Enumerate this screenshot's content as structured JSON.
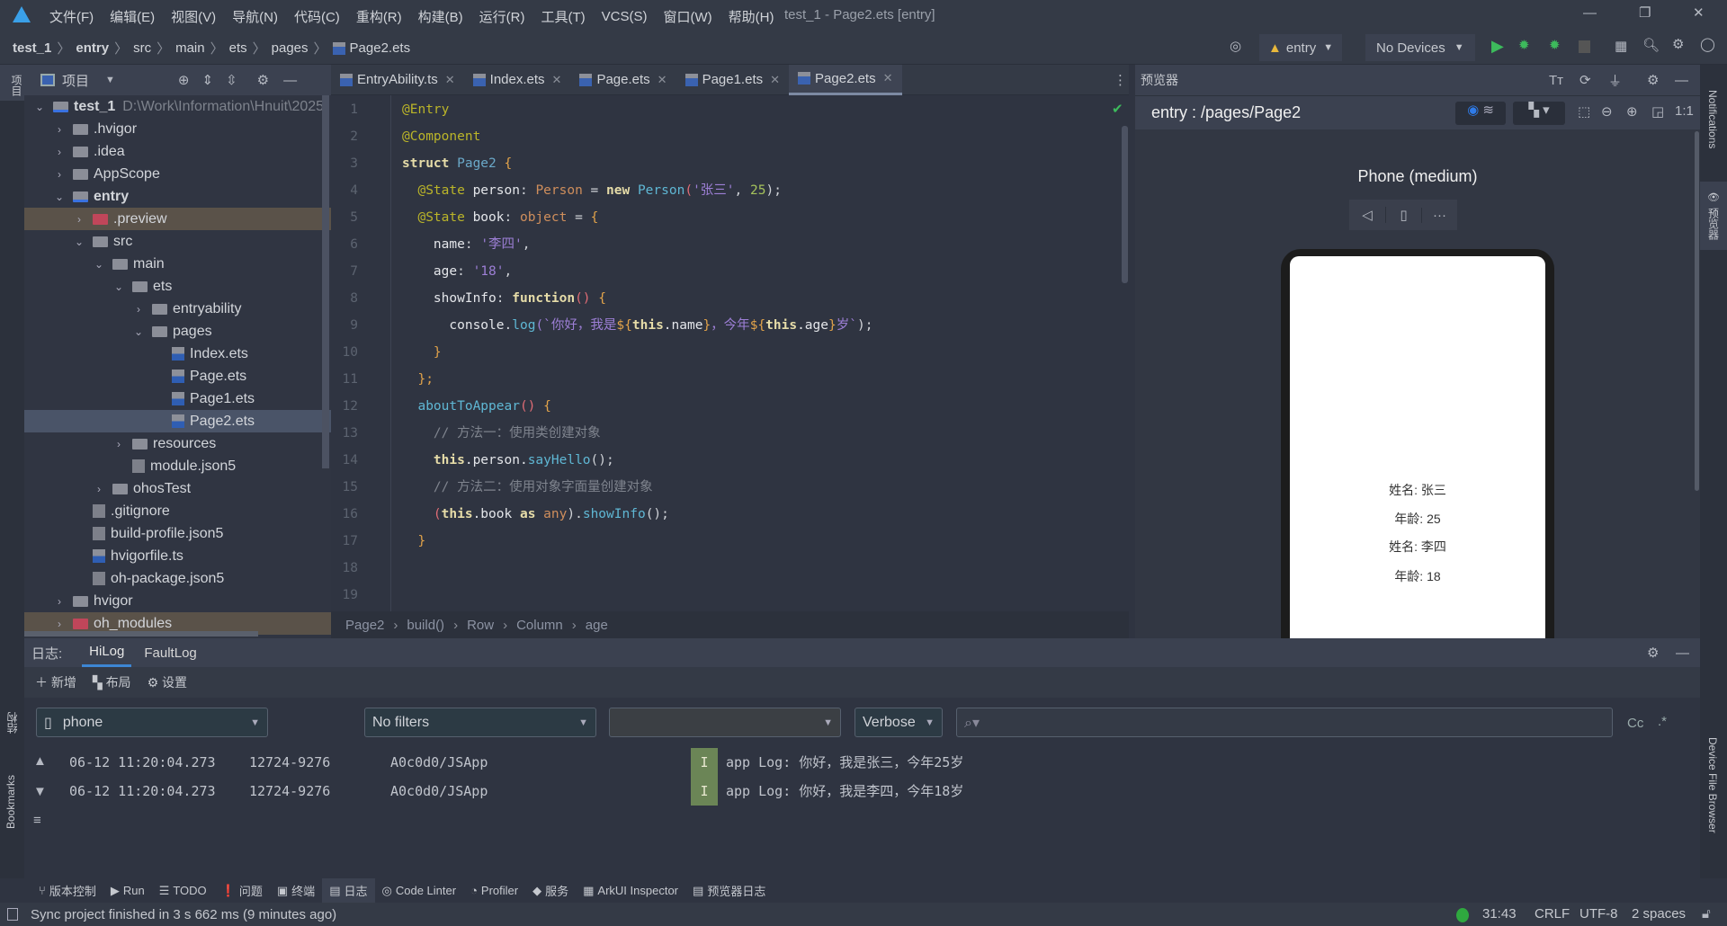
{
  "titlebar": {
    "menus": [
      "文件(F)",
      "编辑(E)",
      "视图(V)",
      "导航(N)",
      "代码(C)",
      "重构(R)",
      "构建(B)",
      "运行(R)",
      "工具(T)",
      "VCS(S)",
      "窗口(W)",
      "帮助(H)"
    ],
    "title": "test_1 - Page2.ets [entry]"
  },
  "breadcrumb": [
    "test_1",
    "entry",
    "src",
    "main",
    "ets",
    "pages",
    "Page2.ets"
  ],
  "run": {
    "module": "entry",
    "device": "No Devices"
  },
  "project": {
    "title": "项目",
    "strip_label": "项目",
    "tree": [
      {
        "label": "test_1",
        "path": "D:\\Work\\Information\\Hnuit\\2025",
        "depth": 0,
        "arrow": "v",
        "icon": "module",
        "bold": true
      },
      {
        "label": ".hvigor",
        "depth": 1,
        "arrow": ">",
        "icon": "folder"
      },
      {
        "label": ".idea",
        "depth": 1,
        "arrow": ">",
        "icon": "folder"
      },
      {
        "label": "AppScope",
        "depth": 1,
        "arrow": ">",
        "icon": "folder"
      },
      {
        "label": "entry",
        "depth": 1,
        "arrow": "v",
        "icon": "module",
        "bold": true
      },
      {
        "label": ".preview",
        "depth": 2,
        "arrow": ">",
        "icon": "folder-red",
        "hl": true
      },
      {
        "label": "src",
        "depth": 2,
        "arrow": "v",
        "icon": "folder"
      },
      {
        "label": "main",
        "depth": 3,
        "arrow": "v",
        "icon": "folder"
      },
      {
        "label": "ets",
        "depth": 4,
        "arrow": "v",
        "icon": "folder"
      },
      {
        "label": "entryability",
        "depth": 5,
        "arrow": ">",
        "icon": "folder"
      },
      {
        "label": "pages",
        "depth": 5,
        "arrow": "v",
        "icon": "folder"
      },
      {
        "label": "Index.ets",
        "depth": 6,
        "arrow": "",
        "icon": "ets"
      },
      {
        "label": "Page.ets",
        "depth": 6,
        "arrow": "",
        "icon": "ets"
      },
      {
        "label": "Page1.ets",
        "depth": 6,
        "arrow": "",
        "icon": "ets"
      },
      {
        "label": "Page2.ets",
        "depth": 6,
        "arrow": "",
        "icon": "ets",
        "sel": true
      },
      {
        "label": "resources",
        "depth": 4,
        "arrow": ">",
        "icon": "folder"
      },
      {
        "label": "module.json5",
        "depth": 4,
        "arrow": "",
        "icon": "json"
      },
      {
        "label": "ohosTest",
        "depth": 3,
        "arrow": ">",
        "icon": "folder"
      },
      {
        "label": ".gitignore",
        "depth": 2,
        "arrow": "",
        "icon": "file"
      },
      {
        "label": "build-profile.json5",
        "depth": 2,
        "arrow": "",
        "icon": "json"
      },
      {
        "label": "hvigorfile.ts",
        "depth": 2,
        "arrow": "",
        "icon": "ts"
      },
      {
        "label": "oh-package.json5",
        "depth": 2,
        "arrow": "",
        "icon": "json"
      },
      {
        "label": "hvigor",
        "depth": 1,
        "arrow": ">",
        "icon": "folder"
      },
      {
        "label": "oh_modules",
        "depth": 1,
        "arrow": ">",
        "icon": "folder-red",
        "hl": true
      }
    ]
  },
  "tabs": [
    {
      "label": "EntryAbility.ts"
    },
    {
      "label": "Index.ets"
    },
    {
      "label": "Page.ets"
    },
    {
      "label": "Page1.ets"
    },
    {
      "label": "Page2.ets",
      "active": true
    }
  ],
  "editor": {
    "lines": [
      [
        [
          "@Entry",
          "an"
        ]
      ],
      [
        [
          "@Component",
          "an"
        ]
      ],
      [
        [
          "struct ",
          "k"
        ],
        [
          "Page2 ",
          "tc"
        ],
        [
          "{",
          "br"
        ]
      ],
      [
        [
          "  @State ",
          "an"
        ],
        [
          "person",
          "id"
        ],
        [
          ": ",
          "pn"
        ],
        [
          "Person",
          "ty"
        ],
        [
          " = ",
          "pn"
        ],
        [
          "new ",
          "k"
        ],
        [
          "Person",
          "fn"
        ],
        [
          "(",
          "pr"
        ],
        [
          "'张三'",
          "st"
        ],
        [
          ", ",
          "pn"
        ],
        [
          "25",
          "nu"
        ],
        [
          ");",
          "pn"
        ]
      ],
      [
        [
          "  @State ",
          "an"
        ],
        [
          "book",
          "id"
        ],
        [
          ": ",
          "pn"
        ],
        [
          "object",
          "ty"
        ],
        [
          " = ",
          "pn"
        ],
        [
          "{",
          "br"
        ]
      ],
      [
        [
          "    name",
          "id"
        ],
        [
          ": ",
          "pn"
        ],
        [
          "'李四'",
          "st"
        ],
        [
          ",",
          "pn"
        ]
      ],
      [
        [
          "    age",
          "id"
        ],
        [
          ": ",
          "pn"
        ],
        [
          "'18'",
          "st"
        ],
        [
          ",",
          "pn"
        ]
      ],
      [
        [
          "    showInfo",
          "id"
        ],
        [
          ": ",
          "pn"
        ],
        [
          "function",
          "k"
        ],
        [
          "() ",
          "pr"
        ],
        [
          "{",
          "br"
        ]
      ],
      [
        [
          "      console",
          "id"
        ],
        [
          ".",
          "pn"
        ],
        [
          "log",
          "fn"
        ],
        [
          "(`你好，我是",
          "st"
        ],
        [
          "${",
          "br"
        ],
        [
          "this",
          "k"
        ],
        [
          ".name",
          "id"
        ],
        [
          "}",
          "br"
        ],
        [
          "，今年",
          "st"
        ],
        [
          "${",
          "br"
        ],
        [
          "this",
          "k"
        ],
        [
          ".age",
          "id"
        ],
        [
          "}",
          "br"
        ],
        [
          "岁`",
          "st"
        ],
        [
          ");",
          "pn"
        ]
      ],
      [
        [
          "    }",
          "br"
        ]
      ],
      [
        [
          "  };",
          "br"
        ]
      ],
      [
        [
          "  aboutToAppear",
          "fn"
        ],
        [
          "() ",
          "pr"
        ],
        [
          "{",
          "br"
        ]
      ],
      [
        [
          "    // 方法一：使用类创建对象",
          "cm"
        ]
      ],
      [
        [
          "    this",
          "k"
        ],
        [
          ".person.",
          "id"
        ],
        [
          "sayHello",
          "fn"
        ],
        [
          "();",
          "pn"
        ]
      ],
      [
        [
          "    // 方法二：使用对象字面量创建对象",
          "cm"
        ]
      ],
      [
        [
          "    (",
          "pr"
        ],
        [
          "this",
          "k"
        ],
        [
          ".book ",
          "id"
        ],
        [
          "as ",
          "k"
        ],
        [
          "any",
          "ty"
        ],
        [
          ").",
          "pn"
        ],
        [
          "showInfo",
          "fn"
        ],
        [
          "();",
          "pn"
        ]
      ],
      [
        [
          "  }",
          "br"
        ]
      ],
      [],
      []
    ],
    "crumbs": [
      "Page2",
      "build()",
      "Row",
      "Column",
      "age"
    ]
  },
  "preview": {
    "title": "预览器",
    "route": "entry : /pages/Page2",
    "device": "Phone (medium)",
    "lines": [
      "姓名: 张三",
      "年龄: 25",
      "姓名: 李四",
      "年龄: 18"
    ],
    "strip_label": "预览器",
    "notifications": "Notifications"
  },
  "log": {
    "label": "日志:",
    "tabs": [
      "HiLog",
      "FaultLog"
    ],
    "tools": [
      "新增",
      "布局",
      "设置"
    ],
    "device": "phone",
    "filter": "No filters",
    "level": "Verbose",
    "regex": "Cc",
    "entries": [
      {
        "time": "06-12 11:20:04.273",
        "pid": "12724-9276",
        "tag": "A0c0d0/JSApp",
        "level": "I",
        "msg": "app Log: 你好，我是张三，今年25岁"
      },
      {
        "time": "06-12 11:20:04.273",
        "pid": "12724-9276",
        "tag": "A0c0d0/JSApp",
        "level": "I",
        "msg": "app Log: 你好，我是李四，今年18岁"
      }
    ],
    "side_labels": [
      "结构",
      "Bookmarks"
    ],
    "right_label": "Device File Browser"
  },
  "toolwindows": [
    "版本控制",
    "Run",
    "TODO",
    "问题",
    "终端",
    "日志",
    "Code Linter",
    "Profiler",
    "服务",
    "ArkUI Inspector",
    "预览器日志"
  ],
  "status": {
    "message": "Sync project finished in 3 s 662 ms (9 minutes ago)",
    "position": "31:43",
    "line_sep": "CRLF",
    "encoding": "UTF-8",
    "indent": "2 spaces"
  }
}
